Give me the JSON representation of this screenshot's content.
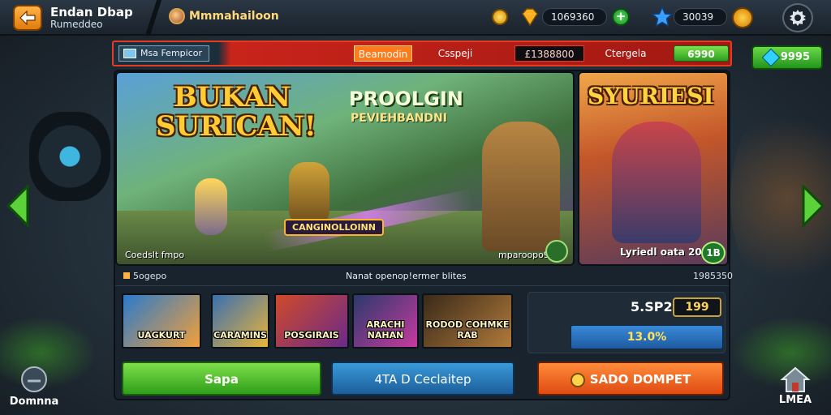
{
  "header": {
    "title": "Endan Dbap",
    "subtitle": "Rumeddeo",
    "username": "Mmmahailoon",
    "gems": "1069360",
    "currency2": "30039",
    "icons": {
      "back": "back-arrow-icon",
      "avatar": "avatar-icon",
      "coin": "coin-icon",
      "gem": "gem-icon",
      "plus": "plus-icon",
      "star": "star-icon",
      "gear": "gear-icon"
    }
  },
  "strip": {
    "left_label": "Msa Fempicor",
    "tab1": "Beamodin",
    "tab2": "Csspeji",
    "price": "£1388800",
    "tab3": "Ctergela",
    "buy": "6990",
    "side_button": "9995"
  },
  "featured": {
    "headline1": "BUKAN",
    "headline2": "SURICAN!",
    "promo1": "PROOLGIN",
    "promo2": "PEVIEHBANDNI",
    "badge": "CANGINOLLOINN",
    "footer_left": "Coedslt fmpo",
    "footer_right": "mparoopo9350",
    "info_left": "5ogepo",
    "info_center": "Nanat openop!ermer blites",
    "info_right": "1985350"
  },
  "side_card": {
    "title": "SYURIESI",
    "caption": "Lyriedl oata 20",
    "badge": "1B"
  },
  "thumbnails": [
    {
      "label": "UAGKURT"
    },
    {
      "label": "CARAMINS"
    },
    {
      "label": "POSGIRAIS"
    },
    {
      "label": "ARACHI NAHAN"
    },
    {
      "label": "RODOD COHMKE RAB"
    }
  ],
  "stats": {
    "value": "5.SP21",
    "badge": "199",
    "progress_label": "13.0%"
  },
  "buttons": {
    "primary": "Sapa",
    "secondary": "4TA D Ceclaitep",
    "orange": "SADO DOMPET"
  },
  "nav": {
    "left": "Domnna",
    "right": "LMEA"
  }
}
